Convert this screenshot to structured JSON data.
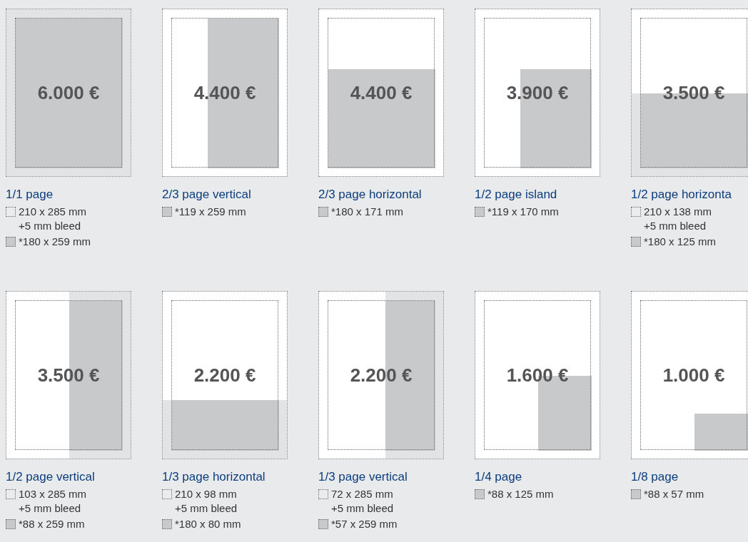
{
  "formats": [
    {
      "price": "6.000 €",
      "title": "1/1 page",
      "kind": "full",
      "bleed": true,
      "specs": [
        {
          "kind": "trim",
          "text": "210 x 285 mm",
          "note": "+5 mm bleed"
        },
        {
          "kind": "type",
          "text": "*180 x 259 mm"
        }
      ]
    },
    {
      "price": "4.400 €",
      "title": "2/3 page vertical",
      "kind": "two-thirds-vertical",
      "bleed": false,
      "specs": [
        {
          "kind": "type",
          "text": "*119 x 259 mm"
        }
      ]
    },
    {
      "price": "4.400 €",
      "title": "2/3 page horizontal",
      "kind": "two-thirds-horizontal",
      "bleed": false,
      "specs": [
        {
          "kind": "type",
          "text": "*180 x 171 mm"
        }
      ]
    },
    {
      "price": "3.900 €",
      "title": "1/2 page island",
      "kind": "island",
      "bleed": false,
      "specs": [
        {
          "kind": "type",
          "text": "*119 x 170 mm"
        }
      ]
    },
    {
      "price": "3.500 €",
      "title": "1/2 page horizonta",
      "kind": "half-horizontal",
      "bleed": true,
      "specs": [
        {
          "kind": "trim",
          "text": "210 x 138 mm",
          "note": "+5 mm bleed"
        },
        {
          "kind": "type",
          "text": "*180 x 125 mm"
        }
      ]
    },
    {
      "price": "3.500 €",
      "title": "1/2 page vertical",
      "kind": "half-vertical",
      "bleed": true,
      "specs": [
        {
          "kind": "trim",
          "text": "103 x 285 mm",
          "note": "+5 mm bleed"
        },
        {
          "kind": "type",
          "text": "*88 x 259 mm"
        }
      ]
    },
    {
      "price": "2.200 €",
      "title": "1/3 page horizontal",
      "kind": "third-horizontal",
      "bleed": true,
      "specs": [
        {
          "kind": "trim",
          "text": "210 x 98 mm",
          "note": "+5 mm bleed"
        },
        {
          "kind": "type",
          "text": "*180 x 80 mm"
        }
      ]
    },
    {
      "price": "2.200 €",
      "title": "1/3 page vertical",
      "kind": "third-vertical",
      "bleed": true,
      "specs": [
        {
          "kind": "trim",
          "text": "72 x 285 mm",
          "note": "+5 mm bleed"
        },
        {
          "kind": "type",
          "text": "*57 x 259 mm"
        }
      ]
    },
    {
      "price": "1.600 €",
      "title": "1/4 page",
      "kind": "quarter",
      "bleed": false,
      "specs": [
        {
          "kind": "type",
          "text": "*88 x 125 mm"
        }
      ]
    },
    {
      "price": "1.000 €",
      "title": "1/8 page",
      "kind": "eighth",
      "bleed": false,
      "specs": [
        {
          "kind": "type",
          "text": "*88 x 57 mm"
        }
      ]
    }
  ]
}
